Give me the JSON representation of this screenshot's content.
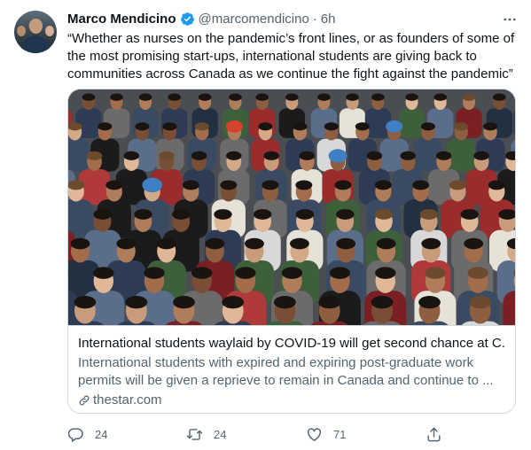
{
  "tweet": {
    "author_name": "Marco Mendicino",
    "handle": "@marcomendicino",
    "separator": "·",
    "time": "6h",
    "more_label": "···",
    "text": "“Whether as nurses on the pandemic’s front lines, or as founders of some of the most promising start-ups, international students are giving back to communities across Canada as we continue the fight against the pandemic”",
    "verified_icon": "verified-badge-icon",
    "accent_color": "#1d9bf0"
  },
  "card": {
    "image_description_icon": "crowd-photo",
    "title": "International students waylaid by COVID-19 will get second chance at C...",
    "description": "International students with expired and expiring post-graduate work permits will be given a reprieve to remain in Canada and continue to ...",
    "domain": "thestar.com"
  },
  "actions": {
    "replies": "24",
    "retweets": "24",
    "likes": "71"
  }
}
